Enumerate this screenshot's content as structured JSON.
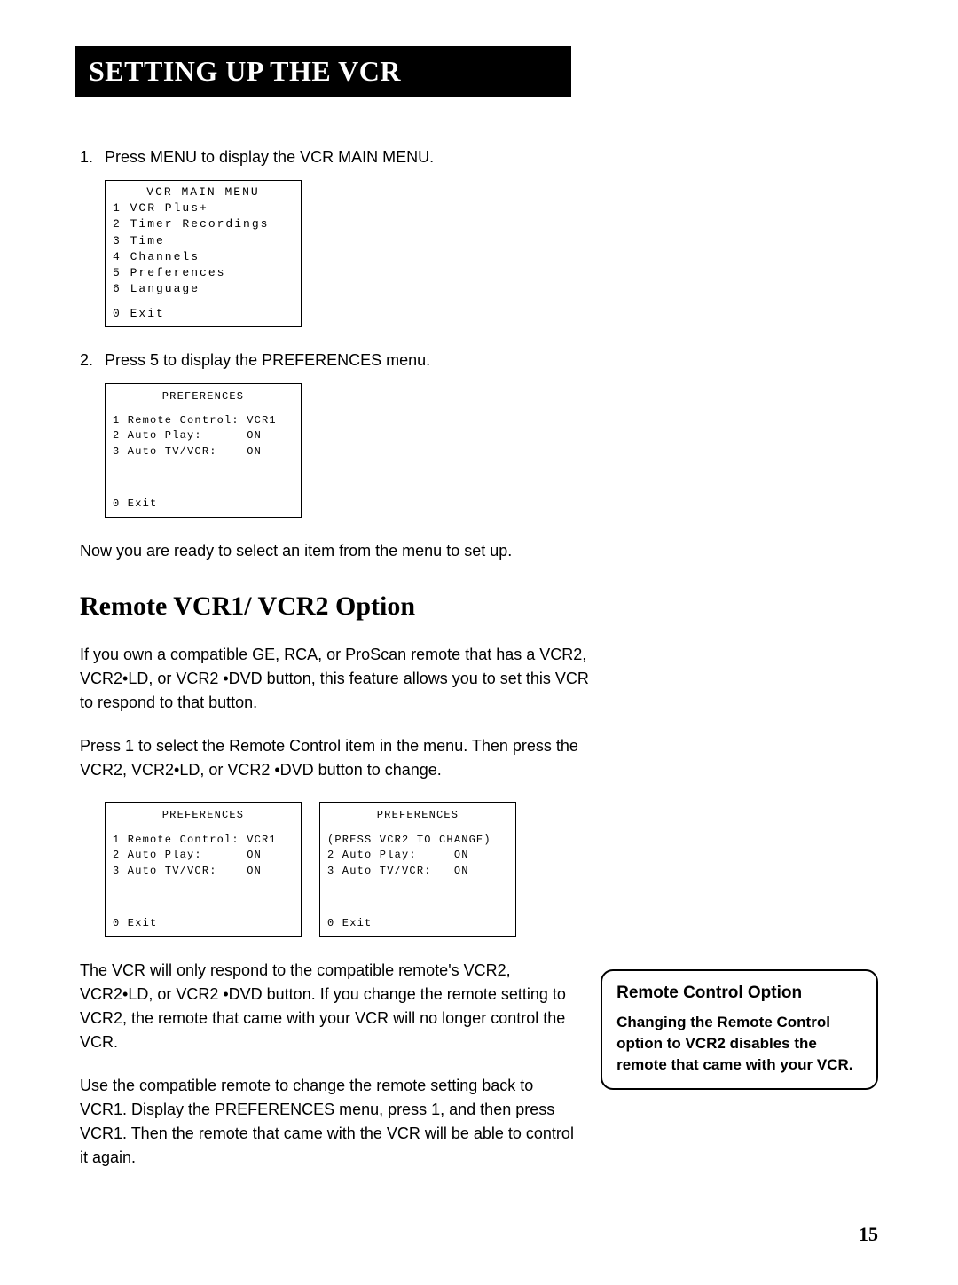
{
  "header": "SETTING UP THE VCR",
  "step1": {
    "num": "1.",
    "text": "Press MENU to display the VCR MAIN MENU."
  },
  "menu1": {
    "title": "VCR MAIN MENU",
    "l1": "1 VCR Plus+",
    "l2": "2 Timer Recordings",
    "l3": "3 Time",
    "l4": "4 Channels",
    "l5": "5 Preferences",
    "l6": "6 Language",
    "l7": "0 Exit"
  },
  "step2": {
    "num": "2.",
    "text": "Press 5 to display the PREFERENCES menu."
  },
  "menu2": {
    "title": "PREFERENCES",
    "l1": "1 Remote Control: VCR1",
    "l2": "2 Auto Play:      ON",
    "l3": "3 Auto TV/VCR:    ON",
    "l4": "0 Exit"
  },
  "para_ready": "Now you are ready to select an item from the menu to set up.",
  "section_title": "Remote VCR1/ VCR2 Option",
  "para_own": "If you own a compatible GE, RCA, or ProScan remote that has a VCR2, VCR2•LD, or VCR2 •DVD button, this feature allows you to set this VCR to respond to that button.",
  "para_press1": "Press 1 to select the Remote Control item in the menu. Then press the VCR2, VCR2•LD, or VCR2 •DVD button to change.",
  "menu3a": {
    "title": "PREFERENCES",
    "l1": "1 Remote Control: VCR1",
    "l2": "2 Auto Play:      ON",
    "l3": "3 Auto TV/VCR:    ON",
    "l4": "0 Exit"
  },
  "menu3b": {
    "title": "PREFERENCES",
    "l1": "(PRESS VCR2 TO CHANGE)",
    "l2": "2 Auto Play:     ON",
    "l3": "3 Auto TV/VCR:   ON",
    "l4": "0 Exit"
  },
  "para_respond": "The VCR will only respond to the compatible remote's VCR2, VCR2•LD, or VCR2 •DVD button.  If you change the remote setting to VCR2, the remote that came with your VCR will no longer control the VCR.",
  "para_use": "Use the compatible remote to change the remote setting back to VCR1. Display the PREFERENCES menu, press 1, and then press VCR1. Then the remote that came with the VCR will be able to control it again.",
  "sidebar": {
    "title": "Remote Control Option",
    "text": "Changing the Remote Control option to VCR2 disables the remote that came with your VCR."
  },
  "page_number": "15"
}
